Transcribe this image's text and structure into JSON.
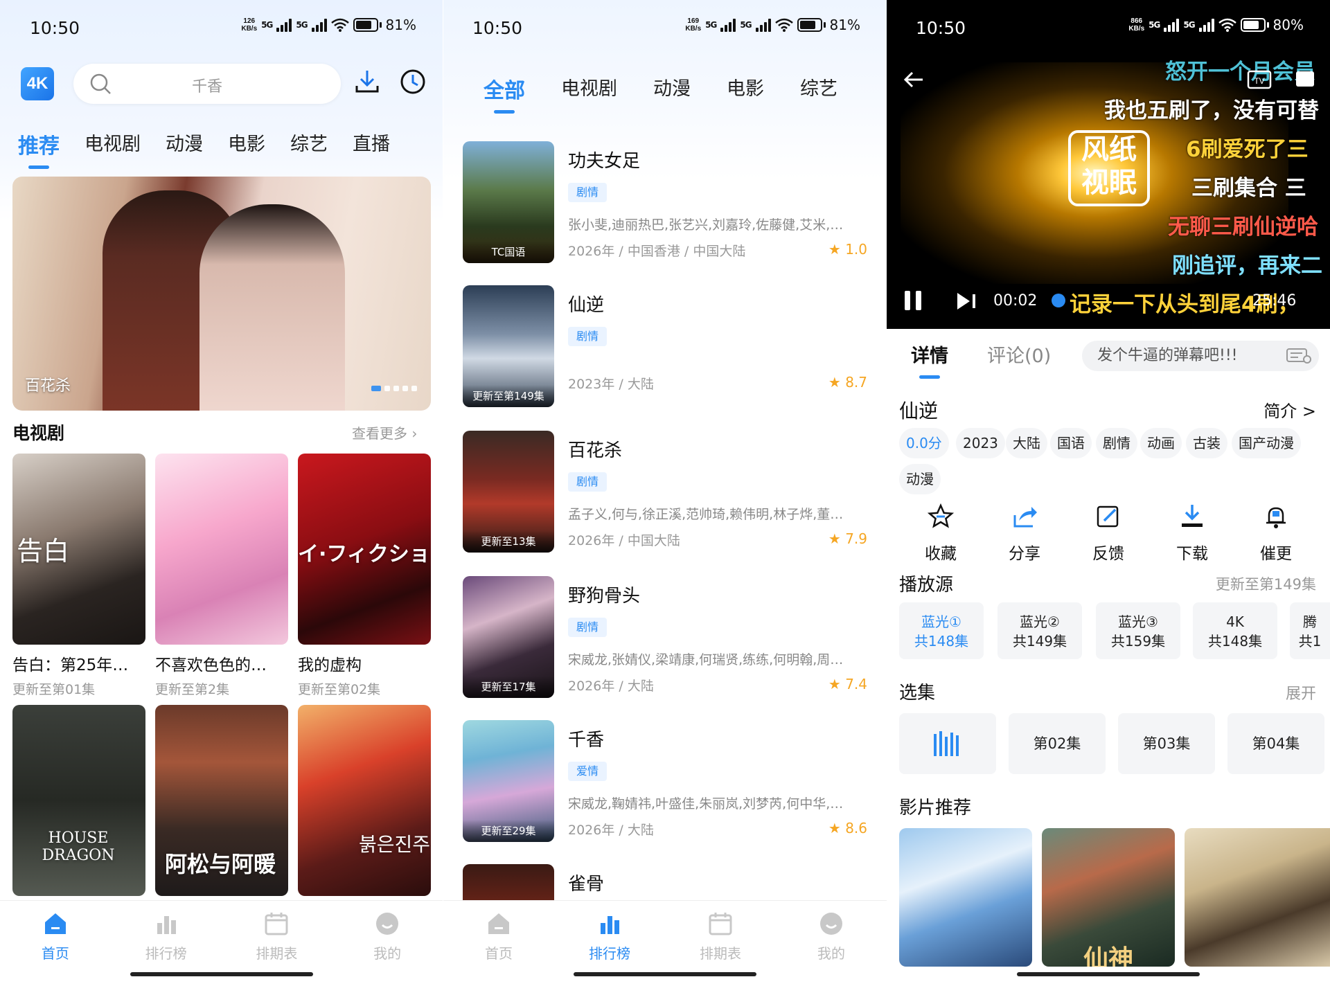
{
  "status": [
    {
      "time": "10:50",
      "speed_top": "126",
      "speed_unit": "KB/s",
      "sig1": "5G",
      "sig2": "5G",
      "battery": "81%",
      "battery_level": 0.81
    },
    {
      "time": "10:50",
      "speed_top": "169",
      "speed_unit": "KB/s",
      "sig1": "5G",
      "sig2": "5G",
      "battery": "81%",
      "battery_level": 0.81
    },
    {
      "time": "10:50",
      "speed_top": "866",
      "speed_unit": "KB/s",
      "sig1": "5G",
      "sig2": "5G",
      "battery": "80%",
      "battery_level": 0.8
    }
  ],
  "home": {
    "logo": "4K",
    "search_placeholder": "千香",
    "tabs": [
      "推荐",
      "电视剧",
      "动漫",
      "电影",
      "综艺",
      "直播"
    ],
    "banner_caption": "百花杀",
    "section_title": "电视剧",
    "section_more": "查看更多 ›",
    "cards": [
      {
        "title": "告白：第25年…",
        "sub": "更新至第01集",
        "poster_text": "告白"
      },
      {
        "title": "不喜欢色色的…",
        "sub": "更新至第2集",
        "poster_text": ""
      },
      {
        "title": "我的虚构",
        "sub": "更新至第02集",
        "poster_text": "イ·フィクショ"
      },
      {
        "poster_text": "HOUSE DRAGON"
      },
      {
        "poster_text": "阿松与阿暖"
      },
      {
        "poster_text": "붉은진주"
      }
    ]
  },
  "ranking": {
    "tabs": [
      "全部",
      "电视剧",
      "动漫",
      "电影",
      "综艺"
    ],
    "items": [
      {
        "title": "功夫女足",
        "genre": "剧情",
        "cast": "张小斐,迪丽热巴,张艺兴,刘嘉玲,佐藤健,艾米,…",
        "meta": "2026年 / 中国香港 / 中国大陆",
        "score": "★ 1.0",
        "badge": "TC国语"
      },
      {
        "title": "仙逆",
        "genre": "剧情",
        "cast": "",
        "meta": "2023年 / 大陆",
        "score": "★ 8.7",
        "badge": "更新至第149集"
      },
      {
        "title": "百花杀",
        "genre": "剧情",
        "cast": "孟子义,何与,徐正溪,范帅琦,赖伟明,林子烨,董…",
        "meta": "2026年 / 中国大陆",
        "score": "★ 7.9",
        "badge": "更新至13集"
      },
      {
        "title": "野狗骨头",
        "genre": "剧情",
        "cast": "宋威龙,张婧仪,梁靖康,何瑞贤,练练,何明翰,周…",
        "meta": "2026年 / 大陆",
        "score": "★ 7.4",
        "badge": "更新至17集"
      },
      {
        "title": "千香",
        "genre": "爱情",
        "cast": "宋威龙,鞠婧祎,叶盛佳,朱丽岚,刘梦芮,何中华,…",
        "meta": "2026年 / 大陆",
        "score": "★ 8.6",
        "badge": "更新至29集"
      },
      {
        "title": "雀骨"
      }
    ]
  },
  "nav": [
    "首页",
    "排行榜",
    "排期表",
    "我的"
  ],
  "detail": {
    "danmaku": [
      "怒开一个月会员",
      "我也五刷了，没有可替",
      "6刷爱死了三",
      "三刷集合 三",
      "无聊三刷仙逆哈",
      "刚追评，再来二",
      "记录一下从头到尾4刷，"
    ],
    "watermark": "风纸视眠",
    "time_current": "00:02",
    "time_total": "25:46",
    "tabs": [
      "详情",
      "评论(0)"
    ],
    "danmu_placeholder": "发个牛逼的弹幕吧!!!",
    "title": "仙逆",
    "intro": "简介 >",
    "chips": [
      "0.0分",
      "2023",
      "大陆",
      "国语",
      "剧情",
      "动画",
      "古装",
      "国产动漫",
      "动漫"
    ],
    "actions": [
      "收藏",
      "分享",
      "反馈",
      "下载",
      "催更"
    ],
    "source_title": "播放源",
    "source_update": "更新至第149集",
    "sources": [
      {
        "name": "蓝光①",
        "count": "共148集"
      },
      {
        "name": "蓝光②",
        "count": "共149集"
      },
      {
        "name": "蓝光③",
        "count": "共159集"
      },
      {
        "name": "4K",
        "count": "共148集"
      },
      {
        "name": "腾",
        "count": "共1"
      }
    ],
    "episode_title": "选集",
    "episode_expand": "展开",
    "episodes": [
      "第02集",
      "第03集",
      "第04集"
    ],
    "recommend_title": "影片推荐",
    "rec_text": "仙神"
  },
  "colors": {
    "accent": "#2a8bf2",
    "star": "#f5a623"
  }
}
